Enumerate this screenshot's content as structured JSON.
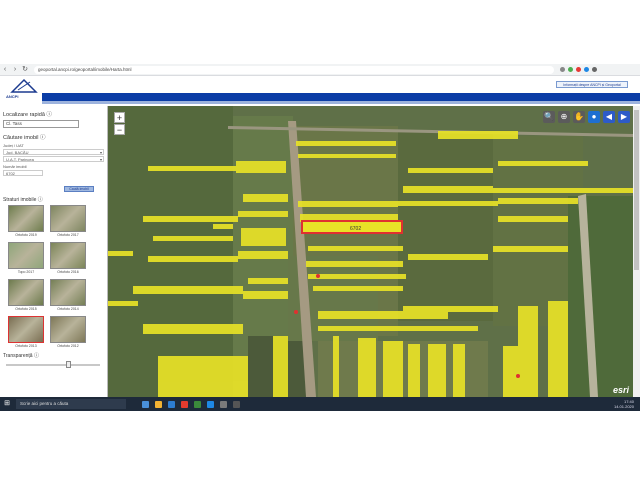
{
  "browser": {
    "url": "geoportal.ancpi.ro/geoportal/imobile/Harta.html",
    "back_icon": "arrow-left-icon",
    "forward_icon": "arrow-right-icon",
    "reload_icon": "reload-icon",
    "extension_colors": [
      "#888888",
      "#4caf50",
      "#e53935",
      "#1e88e5",
      "#666666"
    ]
  },
  "header": {
    "logo_text": "ANCPI",
    "link_label": "Informații despre ANCPI și Geoportal",
    "band_color": "#0b3da6"
  },
  "sidebar": {
    "search_title": "Localizare rapidă ⓘ",
    "search_value": "Cl. Tass",
    "cadastral_title": "Căutare imobil ⓘ",
    "uat_label": "Județ / UAT",
    "select_value_1": "Jud. BACĂU",
    "select_value_2": "U.A.T. Parincea",
    "id_label": "Număr imobil",
    "id_value": "6702",
    "search_button": "Caută imobil",
    "layers_title": "Straturi imobile ⓘ",
    "layers": [
      {
        "label": "Ortofoto 2019",
        "color": "#6f7d4e"
      },
      {
        "label": "Ortofoto 2017",
        "color": "#7f8660"
      },
      {
        "label": "Topo 2017",
        "color": "#8fa67a"
      },
      {
        "label": "Ortofoto 2016",
        "color": "#7b8558"
      },
      {
        "label": "Ortofoto 2015",
        "color": "#6d7a4d"
      },
      {
        "label": "Ortofoto 2014",
        "color": "#757f56"
      },
      {
        "label": "Ortofoto 2013",
        "color": "#7a6e52"
      },
      {
        "label": "Ortofoto 2012",
        "color": "#7e7858"
      }
    ],
    "transparency_title": "Transparență ⓘ",
    "transparency_level": 0.66
  },
  "map": {
    "zoom_in": "+",
    "zoom_out": "−",
    "tools": [
      {
        "icon": "zoom-box-icon",
        "glyph": "🔍",
        "color": "#5b5b5b"
      },
      {
        "icon": "zoom-icon",
        "glyph": "⊕",
        "color": "#5b5b5b"
      },
      {
        "icon": "pan-icon",
        "glyph": "✋",
        "color": "#5b5b5b"
      },
      {
        "icon": "globe-icon",
        "glyph": "●",
        "color": "#1e6fd1"
      },
      {
        "icon": "back-arrow-icon",
        "glyph": "◀",
        "color": "#2d5bc8"
      },
      {
        "icon": "forward-arrow-icon",
        "glyph": "▶",
        "color": "#2d5bc8"
      }
    ],
    "parcel_label": "6702",
    "attribution": "esri",
    "parcel_color": "#e8e227",
    "selected_color": "#e03030"
  },
  "taskbar": {
    "search_placeholder": "Scrie aici pentru a căuta",
    "time": "17:40",
    "date": "14.01.2020",
    "apps": [
      "#4a90d9",
      "#f2b233",
      "#2d7dd2",
      "#e33b2e",
      "#3b8a3b",
      "#1e88e5",
      "#7a7a7a",
      "#555555"
    ]
  }
}
